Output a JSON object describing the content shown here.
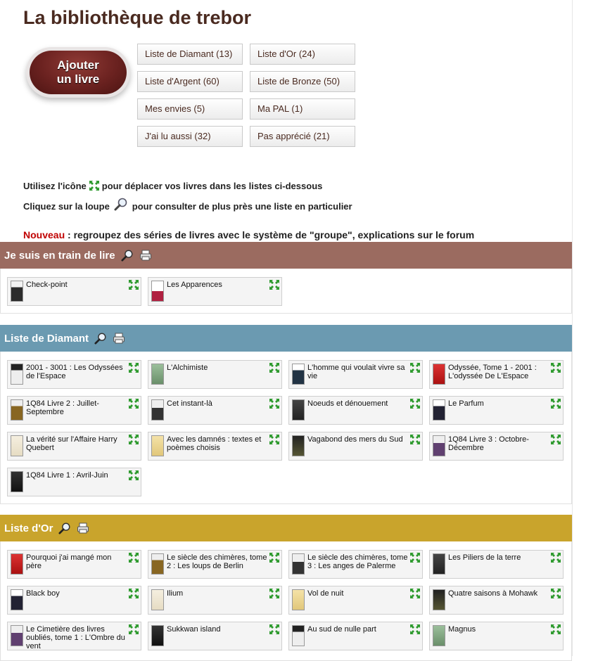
{
  "page": {
    "title": "La bibliothèque de trebor"
  },
  "add_button": {
    "line1": "Ajouter",
    "line2": "un livre"
  },
  "list_buttons": [
    "Liste de Diamant (13)",
    "Liste d'Or (24)",
    "Liste d'Argent (60)",
    "Liste de Bronze (50)",
    "Mes envies (5)",
    "Ma PAL (1)",
    "J'ai lu aussi (32)",
    "Pas apprécié (21)"
  ],
  "info": {
    "line1_before": "Utilisez l'icône",
    "line1_after": "pour déplacer vos livres dans les listes ci-dessous",
    "line2_before": "Cliquez sur la loupe",
    "line2_after": "pour consulter de plus près une liste en particulier",
    "line3_label": "Nouveau",
    "line3_text": " : regroupez des séries de livres avec le système de \"groupe\", explications sur le forum"
  },
  "colors": {
    "reading": "#9b6b60",
    "diamant": "#6b9ab1",
    "or": "#c9a42c",
    "title": "#4a2a20",
    "nouveau": "#c00000"
  },
  "sections": [
    {
      "title": "Je suis en train de lire",
      "books": [
        "Check-point",
        "Les Apparences"
      ]
    },
    {
      "title": "Liste de Diamant",
      "books": [
        "2001 - 3001 : Les Odyssées de l'Espace",
        "L'Alchimiste",
        "L'homme qui voulait vivre sa vie",
        "Odyssée, Tome 1 - 2001 : L'odyssée De L'Espace",
        "1Q84 Livre 2 : Juillet-Septembre",
        "Cet instant-là",
        "Noeuds et dénouement",
        "Le Parfum",
        "La vérité sur l'Affaire Harry Quebert",
        "Avec les damnés : textes et poèmes choisis",
        "Vagabond des mers du Sud",
        "1Q84 Livre 3 : Octobre-Décembre",
        "1Q84 Livre 1 : Avril-Juin"
      ]
    },
    {
      "title": "Liste d'Or",
      "books": [
        "Pourquoi j'ai mangé mon père",
        "Le siècle des chimères, tome 2 : Les loups de Berlin",
        "Le siècle des chimères, tome 3 : Les anges de Palerme",
        "Les Piliers de la terre",
        "Black boy",
        "Ilium",
        "Vol de nuit",
        "Quatre saisons à Mohawk",
        "Le Cimetière des livres oubliés, tome 1 : L'Ombre du vent",
        "Sukkwan island",
        "Au sud de nulle part",
        "Magnus"
      ]
    }
  ]
}
